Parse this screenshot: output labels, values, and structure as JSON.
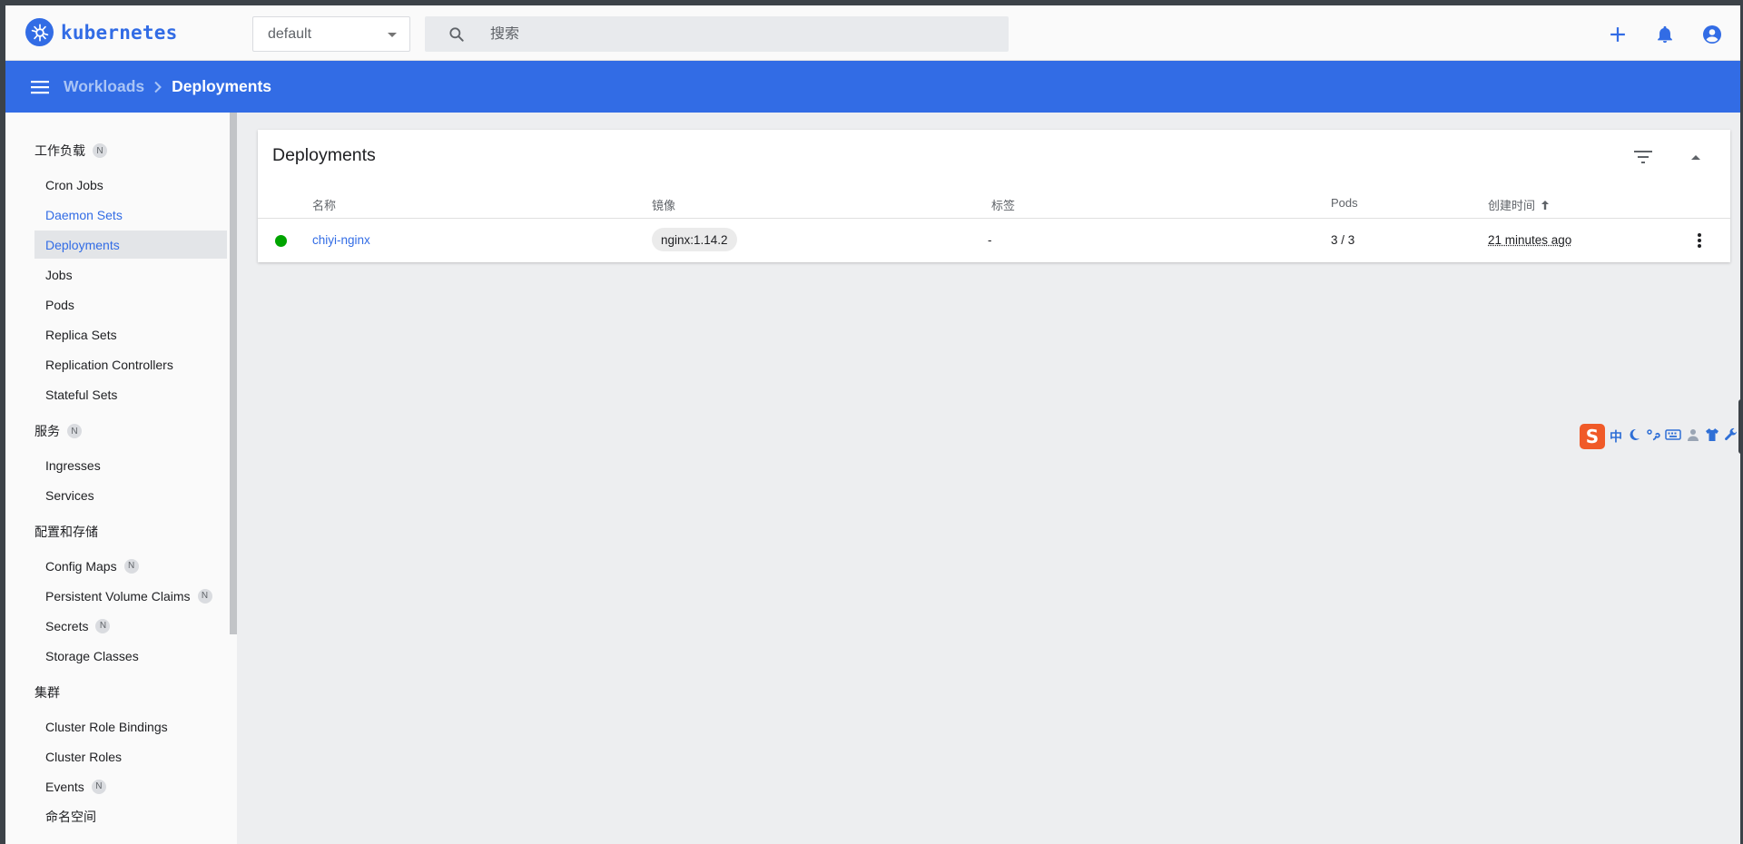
{
  "topbar": {
    "logo_text": "kubernetes",
    "namespace": "default",
    "search_placeholder": "搜索"
  },
  "breadcrumb": {
    "parent": "Workloads",
    "current": "Deployments"
  },
  "sidebar": {
    "badge": "N",
    "workloads": {
      "title": "工作负载",
      "items": [
        "Cron Jobs",
        "Daemon Sets",
        "Deployments",
        "Jobs",
        "Pods",
        "Replica Sets",
        "Replication Controllers",
        "Stateful Sets"
      ]
    },
    "services": {
      "title": "服务",
      "items": [
        "Ingresses",
        "Services"
      ]
    },
    "config": {
      "title": "配置和存储",
      "items": [
        "Config Maps",
        "Persistent Volume Claims",
        "Secrets",
        "Storage Classes"
      ]
    },
    "cluster": {
      "title": "集群",
      "items": [
        "Cluster Role Bindings",
        "Cluster Roles",
        "Events",
        "命名空间"
      ]
    }
  },
  "card": {
    "title": "Deployments",
    "columns": {
      "name": "名称",
      "images": "镜像",
      "labels": "标签",
      "pods": "Pods",
      "created": "创建时间"
    },
    "rows": [
      {
        "status": "running",
        "name": "chiyi-nginx",
        "image": "nginx:1.14.2",
        "labels": "-",
        "pods": "3 / 3",
        "created": "21 minutes ago"
      }
    ]
  },
  "ime": {
    "logo": "S",
    "mode": "中"
  },
  "colors": {
    "brand": "#326ce5",
    "status_ok": "#00a400"
  }
}
